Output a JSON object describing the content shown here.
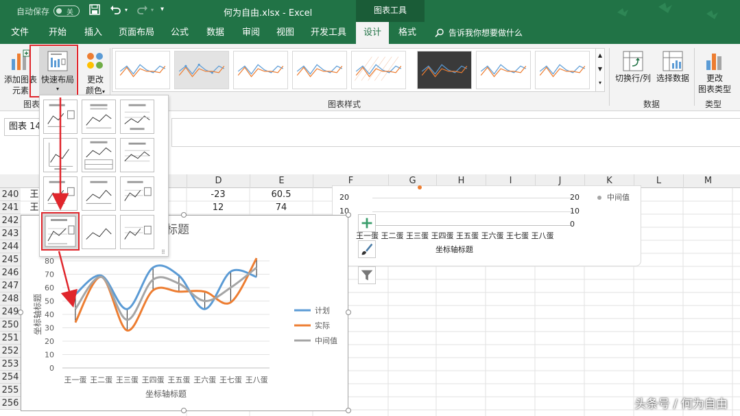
{
  "titlebar": {
    "autosave_label": "自动保存",
    "autosave_state": "关",
    "file_title": "何为自由.xlsx  -  Excel",
    "context_header": "图表工具"
  },
  "tabs": [
    "文件",
    "开始",
    "插入",
    "页面布局",
    "公式",
    "数据",
    "审阅",
    "视图",
    "开发工具",
    "设计",
    "格式"
  ],
  "active_tab": "设计",
  "tell_me": "告诉我你想要做什么",
  "ribbon": {
    "add_element": [
      "添加图表",
      "元素"
    ],
    "quick_layout": "快速布局",
    "change_color": [
      "更改",
      "颜色"
    ],
    "switch_rowcol": "切换行/列",
    "select_data": "选择数据",
    "change_type": [
      "更改",
      "图表类型"
    ],
    "group_layouts": "图表",
    "group_styles": "图表样式",
    "group_data": "数据",
    "group_type": "类型"
  },
  "namebox": "图表 14",
  "columns": [
    "D",
    "E",
    "F",
    "G",
    "H",
    "I",
    "J",
    "K",
    "L",
    "M"
  ],
  "rows": [
    "240",
    "241",
    "242",
    "243",
    "244",
    "245",
    "246",
    "247",
    "248",
    "249",
    "250",
    "251",
    "252",
    "253",
    "254",
    "255",
    "256"
  ],
  "cells": {
    "a240": "王",
    "a241": "王",
    "d240": "-23",
    "e240": "60.5",
    "d241": "12",
    "e241": "74"
  },
  "chart_data": {
    "type": "line",
    "title": "图表标题",
    "xlabel": "坐标轴标题",
    "ylabel": "坐标轴标题",
    "ylim": [
      0,
      80
    ],
    "yticks": [
      0,
      10,
      20,
      30,
      40,
      50,
      60,
      70,
      80
    ],
    "categories": [
      "王一蛋",
      "王二蛋",
      "王三蛋",
      "王四蛋",
      "王五蛋",
      "王六蛋",
      "王七蛋",
      "王八蛋"
    ],
    "series": [
      {
        "name": "计划",
        "color": "#5b9bd5",
        "values": [
          55,
          69,
          44,
          75,
          69,
          44,
          72,
          68
        ]
      },
      {
        "name": "实际",
        "color": "#ed7d31",
        "values": [
          34,
          68,
          28,
          58,
          57,
          57,
          49,
          82
        ]
      },
      {
        "name": "中间值",
        "color": "#a5a5a5",
        "values": [
          44,
          68,
          36,
          66,
          63,
          50,
          60,
          75
        ]
      }
    ],
    "grid": true,
    "legend": "right"
  },
  "chart2": {
    "left_ticks": [
      "20",
      "10"
    ],
    "right_ticks": [
      "20",
      "10",
      "0"
    ],
    "categories": "王一蛋 王二蛋 王三蛋 王四蛋 王五蛋 王六蛋 王七蛋 王八蛋",
    "xlabel": "坐标轴标题",
    "legend": "中间值"
  },
  "watermark": "头条号 / 何为自由",
  "colors": {
    "excel_green": "#217346",
    "highlight_red": "#e0262c"
  }
}
